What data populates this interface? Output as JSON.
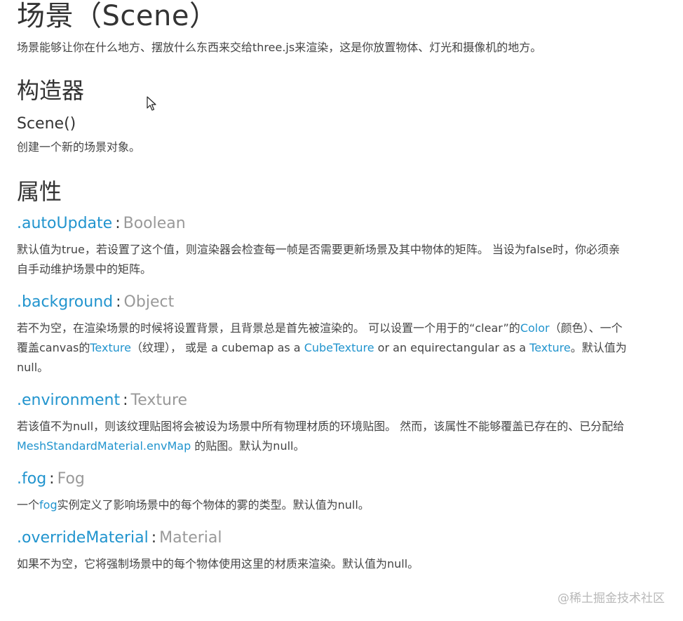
{
  "title": "场景（Scene）",
  "intro": "场景能够让你在什么地方、摆放什么东西来交给three.js来渲染，这是你放置物体、灯光和摄像机的地方。",
  "constructor_section": {
    "heading": "构造器",
    "signature": "Scene()",
    "description": "创建一个新的场景对象。"
  },
  "properties_section": {
    "heading": "属性",
    "items": [
      {
        "name": ".autoUpdate",
        "type": "Boolean",
        "desc": "默认值为true，若设置了这个值，则渲染器会检查每一帧是否需要更新场景及其中物体的矩阵。 当设为false时，你必须亲自手动维护场景中的矩阵。"
      },
      {
        "name": ".background",
        "type": "Object",
        "desc_parts": [
          "若不为空，在渲染场景的时候将设置背景，且背景总是首先被渲染的。 可以设置一个用于的“clear”的",
          "Color",
          "（颜色）、一个覆盖canvas的",
          "Texture",
          "（纹理）， 或是 a cubemap as a ",
          "CubeTexture",
          " or an equirectangular as a ",
          "Texture",
          "。默认值为null。"
        ]
      },
      {
        "name": ".environment",
        "type": "Texture",
        "desc_parts": [
          "若该值不为null，则该纹理贴图将会被设为场景中所有物理材质的环境贴图。 然而，该属性不能够覆盖已存在的、已分配给 ",
          "MeshStandardMaterial.envMap",
          " 的贴图。默认为null。"
        ]
      },
      {
        "name": ".fog",
        "type": "Fog",
        "desc_parts": [
          "一个",
          "fog",
          "实例定义了影响场景中的每个物体的雾的类型。默认值为null。"
        ]
      },
      {
        "name": ".overrideMaterial",
        "type": "Material",
        "desc": "如果不为空，它将强制场景中的每个物体使用这里的材质来渲染。默认值为null。"
      }
    ]
  },
  "watermark": "@稀土掘金技术社区",
  "colors": {
    "link": "#2194ce",
    "type": "#999999",
    "heading": "#333333",
    "text": "#444444"
  },
  "icons": {
    "cursor": "mouse-pointer-icon"
  }
}
